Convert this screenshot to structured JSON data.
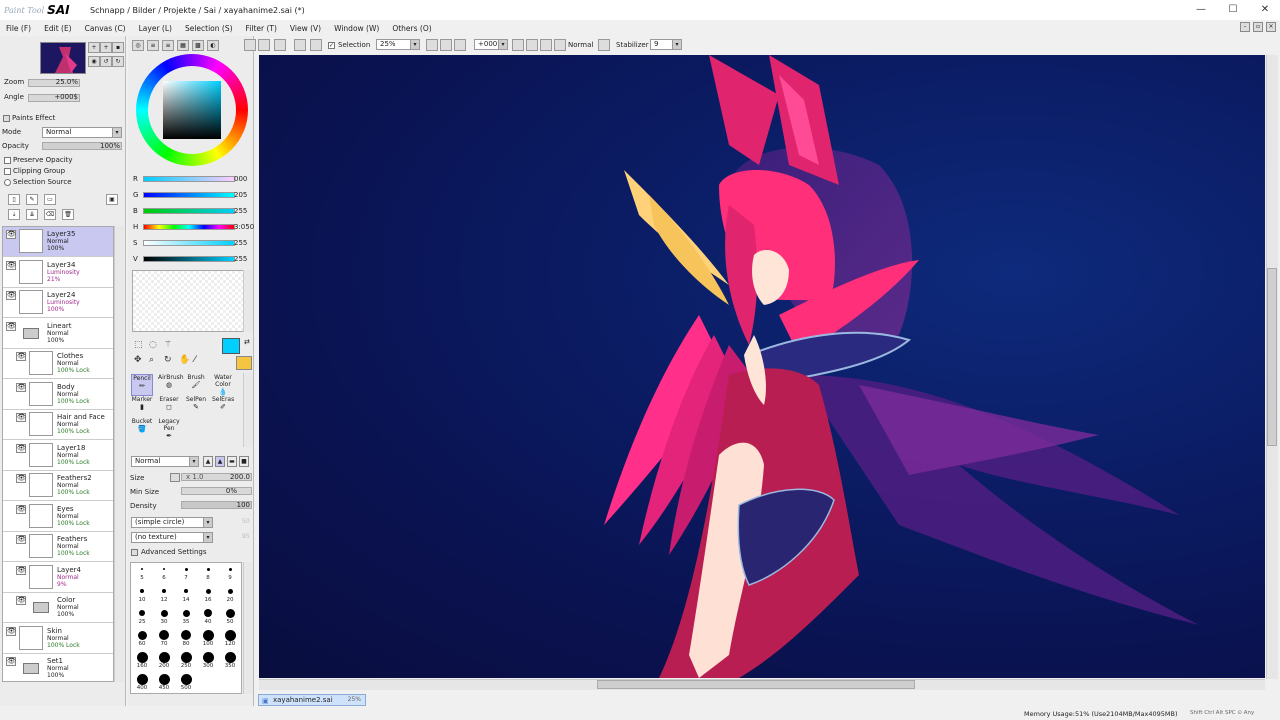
{
  "app": {
    "logo_prefix": "Paint Tool",
    "logo_name": "SAI",
    "title": "Schnapp / Bilder / Projekte / Sai / xayahanime2.sai (*)"
  },
  "window_controls": {
    "minimize": "—",
    "maximize": "☐",
    "close": "✕"
  },
  "menu": [
    "File (F)",
    "Edit (E)",
    "Canvas (C)",
    "Layer (L)",
    "Selection (S)",
    "Filter (T)",
    "View (V)",
    "Window (W)",
    "Others (O)"
  ],
  "navigator": {
    "zoom_label": "Zoom",
    "zoom_value": "25.0%",
    "angle_label": "Angle",
    "angle_value": "+000$"
  },
  "layer_props": {
    "paints_effect": "Paints Effect",
    "mode_label": "Mode",
    "mode_value": "Normal",
    "opacity_label": "Opacity",
    "opacity_value": "100%",
    "preserve_opacity": "Preserve Opacity",
    "clipping_group": "Clipping Group",
    "selection_source": "Selection Source"
  },
  "layers": [
    {
      "name": "Layer35",
      "mode": "Normal",
      "opacity": "100%",
      "indent": 0,
      "selected": true,
      "folder": false,
      "style": "normal"
    },
    {
      "name": "Layer34",
      "mode": "Luminosity",
      "opacity": "21%",
      "indent": 0,
      "selected": false,
      "folder": false,
      "style": "lum"
    },
    {
      "name": "Layer24",
      "mode": "Luminosity",
      "opacity": "100%",
      "indent": 0,
      "selected": false,
      "folder": false,
      "style": "lum"
    },
    {
      "name": "Lineart",
      "mode": "Normal",
      "opacity": "100%",
      "indent": 0,
      "selected": false,
      "folder": true,
      "style": "normal"
    },
    {
      "name": "Clothes",
      "mode": "Normal",
      "opacity": "100% Lock",
      "indent": 1,
      "selected": false,
      "folder": false,
      "style": "lock"
    },
    {
      "name": "Body",
      "mode": "Normal",
      "opacity": "100% Lock",
      "indent": 1,
      "selected": false,
      "folder": false,
      "style": "lock"
    },
    {
      "name": "Hair and Face",
      "mode": "Normal",
      "opacity": "100% Lock",
      "indent": 1,
      "selected": false,
      "folder": false,
      "style": "lock"
    },
    {
      "name": "Layer18",
      "mode": "Normal",
      "opacity": "100% Lock",
      "indent": 1,
      "selected": false,
      "folder": false,
      "style": "lock"
    },
    {
      "name": "Feathers2",
      "mode": "Normal",
      "opacity": "100% Lock",
      "indent": 1,
      "selected": false,
      "folder": false,
      "style": "lock"
    },
    {
      "name": "Eyes",
      "mode": "Normal",
      "opacity": "100% Lock",
      "indent": 1,
      "selected": false,
      "folder": false,
      "style": "lock"
    },
    {
      "name": "Feathers",
      "mode": "Normal",
      "opacity": "100% Lock",
      "indent": 1,
      "selected": false,
      "folder": false,
      "style": "lock"
    },
    {
      "name": "Layer4",
      "mode": "Normal",
      "opacity": "9%",
      "indent": 1,
      "selected": false,
      "folder": false,
      "style": "lum"
    },
    {
      "name": "Color",
      "mode": "Normal",
      "opacity": "100%",
      "indent": 1,
      "selected": false,
      "folder": true,
      "style": "normal"
    },
    {
      "name": "Skin",
      "mode": "Normal",
      "opacity": "100% Lock",
      "indent": 0,
      "selected": false,
      "folder": false,
      "style": "lock"
    },
    {
      "name": "Set1",
      "mode": "Normal",
      "opacity": "100%",
      "indent": 0,
      "selected": false,
      "folder": true,
      "style": "normal"
    }
  ],
  "color": {
    "current_hex": "#00CFFF",
    "secondary_hex": "#F5C542",
    "sliders": [
      {
        "label": "R",
        "value": "000"
      },
      {
        "label": "G",
        "value": "205"
      },
      {
        "label": "B",
        "value": "255"
      },
      {
        "label": "H",
        "value": "3:050"
      },
      {
        "label": "S",
        "value": "255"
      },
      {
        "label": "V",
        "value": "255"
      }
    ]
  },
  "tools": [
    {
      "label": "Pencil",
      "selected": true
    },
    {
      "label": "AirBrush",
      "selected": false
    },
    {
      "label": "Brush",
      "selected": false
    },
    {
      "label": "Water Color",
      "selected": false
    },
    {
      "label": "Marker",
      "selected": false
    },
    {
      "label": "Eraser",
      "selected": false
    },
    {
      "label": "SelPen",
      "selected": false
    },
    {
      "label": "SelEras",
      "selected": false
    },
    {
      "label": "Bucket",
      "selected": false
    },
    {
      "label": "Legacy Pen",
      "selected": false
    }
  ],
  "brush": {
    "blend_mode": "Normal",
    "size_label": "Size",
    "size_mult": "x 1.0",
    "size_value": "200.0",
    "min_size_label": "Min Size",
    "min_size_value": "0%",
    "density_label": "Density",
    "density_value": "100",
    "shape": "(simple circle)",
    "shape_val": "50",
    "texture": "(no texture)",
    "texture_val": "95",
    "advanced": "Advanced Settings"
  },
  "brush_sizes": [
    "5",
    "6",
    "7",
    "8",
    "9",
    "10",
    "12",
    "14",
    "16",
    "20",
    "25",
    "30",
    "35",
    "40",
    "50",
    "60",
    "70",
    "80",
    "100",
    "120",
    "160",
    "200",
    "250",
    "300",
    "350",
    "400",
    "450",
    "500"
  ],
  "toolbar": {
    "selection_label": "Selection",
    "zoom_value": "25%",
    "angle_value": "+000°",
    "blend_label": "Normal",
    "stabilizer_label": "Stabilizer",
    "stabilizer_value": "9"
  },
  "document_tab": {
    "name": "xayahanime2.sai",
    "zoom": "25%"
  },
  "status": {
    "memory": "Memory Usage:51% (Use2104MB/Max4095MB)",
    "keys": "Shift Ctrl Alt SPC ⊙ Any"
  }
}
